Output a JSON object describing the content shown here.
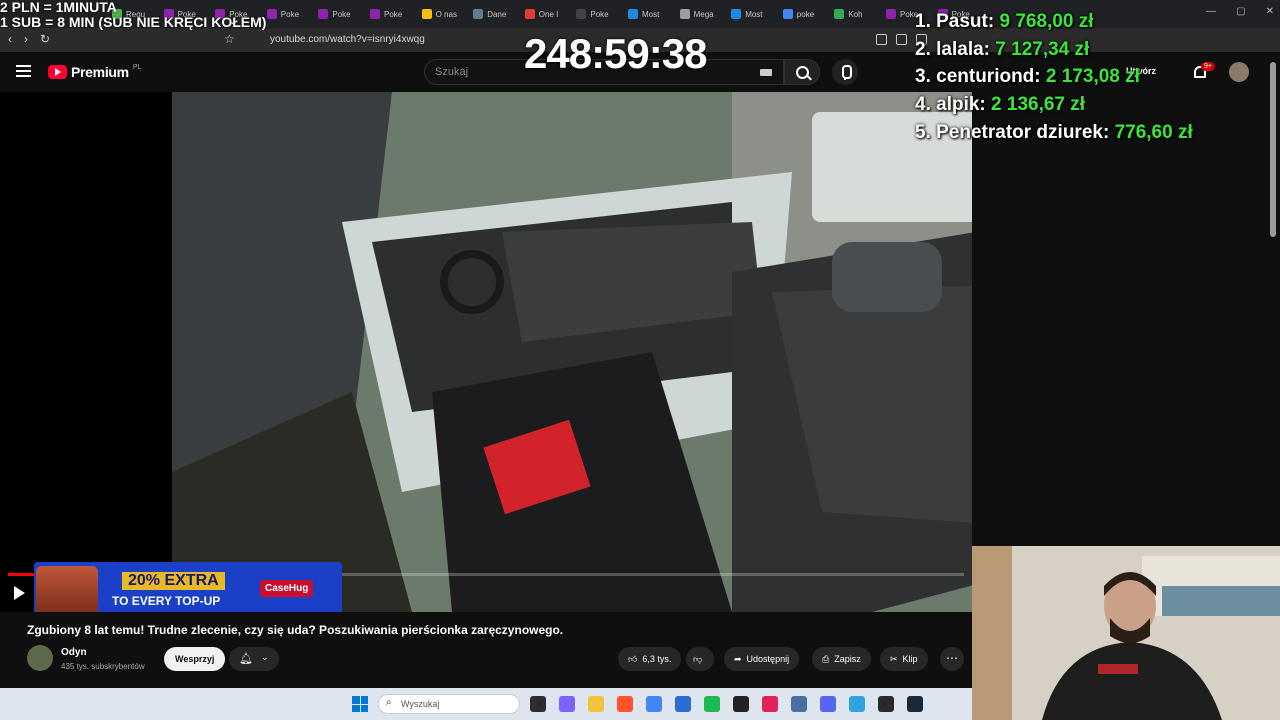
{
  "browser": {
    "tabs": [
      {
        "label": "Regu",
        "color": "#4caf50"
      },
      {
        "label": "Poke",
        "color": "#8e24aa"
      },
      {
        "label": "Poke",
        "color": "#8e24aa"
      },
      {
        "label": "Poke",
        "color": "#8e24aa"
      },
      {
        "label": "Poke",
        "color": "#8e24aa"
      },
      {
        "label": "Poke",
        "color": "#8e24aa"
      },
      {
        "label": "O nas",
        "color": "#f4c20d"
      },
      {
        "label": "Dane",
        "color": "#607d8b"
      },
      {
        "label": "One I",
        "color": "#e53935"
      },
      {
        "label": "Poke",
        "color": "#424242"
      },
      {
        "label": "Most",
        "color": "#1e88e5"
      },
      {
        "label": "Mega",
        "color": "#9e9e9e"
      },
      {
        "label": "Most",
        "color": "#1e88e5"
      },
      {
        "label": "poke",
        "color": "#4285f4"
      },
      {
        "label": "Koh",
        "color": "#34a853"
      },
      {
        "label": "Poke",
        "color": "#8e24aa"
      },
      {
        "label": "Poke",
        "color": "#8e24aa"
      }
    ],
    "url": "youtube.com/watch?v=isnryi4xwqg"
  },
  "youtube": {
    "logo_text": "Premium",
    "region": "PL",
    "search_placeholder": "Szukaj",
    "create_label": "Utwórz",
    "notif_badge": "9+",
    "video_title": "Zgubiony 8 lat temu! Trudne zlecenie, czy się uda? Poszukiwania pierścionka zaręczynowego.",
    "channel_name": "Odyn",
    "channel_subs": "435 tys. subskrybentów",
    "support_label": "Wesprzyj",
    "likes": "6,3 tys.",
    "share_label": "Udostępnij",
    "save_label": "Zapisz",
    "clip_label": "Klip",
    "progress_fraction": 0.03
  },
  "ad": {
    "line1": "20% EXTRA",
    "line2": "TO EVERY TOP-UP",
    "brand": "CaseHug"
  },
  "stream_overlay": {
    "counter_line1": "2 PLN = 1MINUTA",
    "counter_line2": "1 SUB = 8 MIN (SUB NIE KRĘCI KOŁEM)",
    "timer": "248:59:38",
    "leaderboard": [
      {
        "rank": "1.",
        "name": "Pasut:",
        "amount": "9 768,00 zł"
      },
      {
        "rank": "2.",
        "name": "lalala:",
        "amount": "7 127,34 zł"
      },
      {
        "rank": "3.",
        "name": "centuriond:",
        "amount": "2 173,08 zł"
      },
      {
        "rank": "4.",
        "name": "alpik:",
        "amount": "2 136,67 zł"
      },
      {
        "rank": "5.",
        "name": "Penetrator dziurek:",
        "amount": "776,60 zł"
      }
    ]
  },
  "taskbar": {
    "search_placeholder": "Wyszukaj",
    "apps": [
      {
        "name": "task-view-icon",
        "color": "#2d2d2d"
      },
      {
        "name": "copilot-icon",
        "color": "#7b61ff"
      },
      {
        "name": "file-explorer-icon",
        "color": "#f3c23b"
      },
      {
        "name": "brave-icon",
        "color": "#fb542b"
      },
      {
        "name": "chrome-icon",
        "color": "#4285f4"
      },
      {
        "name": "store-icon",
        "color": "#2b6cd4"
      },
      {
        "name": "spotify-icon",
        "color": "#1db954"
      },
      {
        "name": "media-app-icon",
        "color": "#222222"
      },
      {
        "name": "opera-icon",
        "color": "#e0245e"
      },
      {
        "name": "calculator-icon",
        "color": "#4a6fa5"
      },
      {
        "name": "discord-icon",
        "color": "#5865f2"
      },
      {
        "name": "notepad-icon",
        "color": "#2ea3dc"
      },
      {
        "name": "obs-icon",
        "color": "#2b2b2b"
      },
      {
        "name": "steam-icon",
        "color": "#1b2838"
      }
    ]
  },
  "colors": {
    "accent_red": "#ff0033",
    "leaderboard_amount": "#39e639"
  }
}
